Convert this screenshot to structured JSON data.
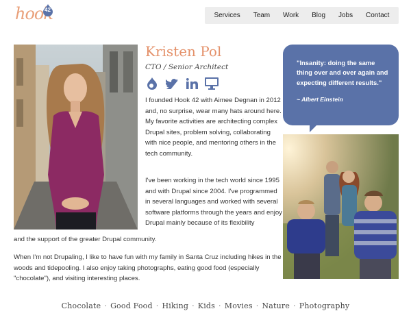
{
  "logo": {
    "text": "hook",
    "badge": "42"
  },
  "nav": {
    "items": [
      {
        "label": "Services"
      },
      {
        "label": "Team"
      },
      {
        "label": "Work"
      },
      {
        "label": "Blog"
      },
      {
        "label": "Jobs"
      },
      {
        "label": "Contact"
      }
    ]
  },
  "profile": {
    "name": "Kristen Pol",
    "role": "CTO / Senior Architect",
    "socials": [
      "drupal-icon",
      "twitter-icon",
      "linkedin-icon",
      "monitor-icon"
    ],
    "bio_p1": "I founded Hook 42 with Aimee Degnan in 2012 and, no surprise, wear many hats around here. My favorite activities are architecting complex Drupal sites, problem solving, collaborating with nice people, and mentoring others in the tech community.",
    "bio_p2_part1": "I've been working in the tech world since 1995 and with Drupal since 2004. I've programmed in several languages and worked with several software platforms through the years and enjoy Drupal mainly because of its flexibility",
    "bio_p2_part2": "and the support of the greater Drupal community.",
    "bio_p3": "When I'm not Drupaling, I like to have fun with my family in Santa Cruz including hikes in the woods and tidepooling. I also enjoy taking photographs, eating good food (especially \"chocolate\"), and visiting interesting places."
  },
  "quote": {
    "text": "\"Insanity: doing the same thing over and over again and expecting different results.\"",
    "author": "~ Albert Einstein"
  },
  "interests": [
    "Chocolate",
    "Good Food",
    "Hiking",
    "Kids",
    "Movies",
    "Nature",
    "Photography"
  ],
  "colors": {
    "accent": "#e4916a",
    "quote_bg": "#5a72a8",
    "nav_bg": "#ededed",
    "icon": "#5a72a8"
  }
}
